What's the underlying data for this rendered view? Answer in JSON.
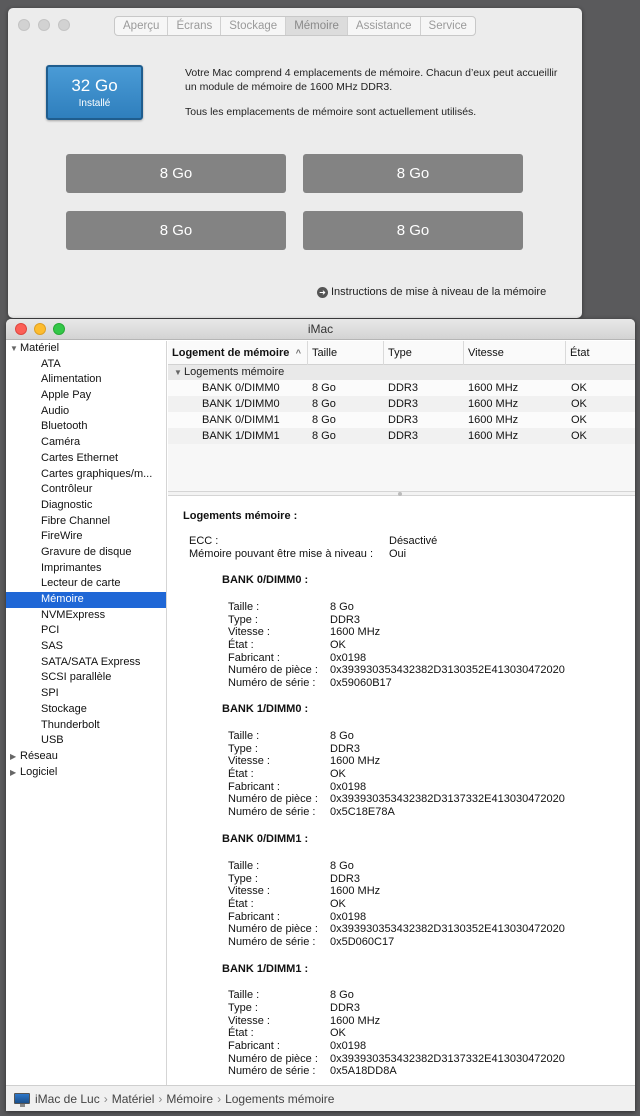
{
  "about": {
    "tabs": [
      "Aperçu",
      "Écrans",
      "Stockage",
      "Mémoire",
      "Assistance",
      "Service"
    ],
    "active_tab": "Mémoire",
    "ram_total": "32 Go",
    "ram_status": "Installé",
    "description_1": "Votre Mac comprend 4 emplacements de mémoire. Chacun d’eux peut accueillir un module de mémoire de 1600 MHz DDR3.",
    "description_2": "Tous les emplacements de mémoire sont actuellement utilisés.",
    "slots": [
      "8 Go",
      "8 Go",
      "8 Go",
      "8 Go"
    ],
    "upgrade_link": "Instructions de mise à niveau de la mémoire"
  },
  "sysinfo": {
    "title": "iMac",
    "sidebar": {
      "materiel_label": "Matériel",
      "items": [
        "ATA",
        "Alimentation",
        "Apple Pay",
        "Audio",
        "Bluetooth",
        "Caméra",
        "Cartes Ethernet",
        "Cartes graphiques/m...",
        "Contrôleur",
        "Diagnostic",
        "Fibre Channel",
        "FireWire",
        "Gravure de disque",
        "Imprimantes",
        "Lecteur de carte",
        "Mémoire",
        "NVMExpress",
        "PCI",
        "SAS",
        "SATA/SATA Express",
        "SCSI parallèle",
        "SPI",
        "Stockage",
        "Thunderbolt",
        "USB"
      ],
      "selected": "Mémoire",
      "reseau_label": "Réseau",
      "logiciel_label": "Logiciel"
    },
    "table": {
      "headers": [
        "Logement de mémoire",
        "Taille",
        "Type",
        "Vitesse",
        "État"
      ],
      "group": "Logements mémoire",
      "rows": [
        [
          "BANK 0/DIMM0",
          "8 Go",
          "DDR3",
          "1600 MHz",
          "OK"
        ],
        [
          "BANK 1/DIMM0",
          "8 Go",
          "DDR3",
          "1600 MHz",
          "OK"
        ],
        [
          "BANK 0/DIMM1",
          "8 Go",
          "DDR3",
          "1600 MHz",
          "OK"
        ],
        [
          "BANK 1/DIMM1",
          "8 Go",
          "DDR3",
          "1600 MHz",
          "OK"
        ]
      ]
    },
    "detail": {
      "heading": "Logements mémoire :",
      "ecc_label": "ECC :",
      "ecc_value": "Désactivé",
      "upgradeable_label": "Mémoire pouvant être mise à niveau :",
      "upgradeable_value": "Oui",
      "field_labels": [
        "Taille :",
        "Type :",
        "Vitesse :",
        "État :",
        "Fabricant :",
        "Numéro de pièce :",
        "Numéro de série :"
      ],
      "banks": [
        {
          "name": "BANK 0/DIMM0 :",
          "values": [
            "8 Go",
            "DDR3",
            "1600 MHz",
            "OK",
            "0x0198",
            "0x393930353432382D3130352E413030472020",
            "0x59060B17"
          ]
        },
        {
          "name": "BANK 1/DIMM0 :",
          "values": [
            "8 Go",
            "DDR3",
            "1600 MHz",
            "OK",
            "0x0198",
            "0x393930353432382D3137332E413030472020",
            "0x5C18E78A"
          ]
        },
        {
          "name": "BANK 0/DIMM1 :",
          "values": [
            "8 Go",
            "DDR3",
            "1600 MHz",
            "OK",
            "0x0198",
            "0x393930353432382D3130352E413030472020",
            "0x5D060C17"
          ]
        },
        {
          "name": "BANK 1/DIMM1 :",
          "values": [
            "8 Go",
            "DDR3",
            "1600 MHz",
            "OK",
            "0x0198",
            "0x393930353432382D3137332E413030472020",
            "0x5A18DD8A"
          ]
        }
      ]
    },
    "pathbar": [
      "iMac de Luc",
      "Matériel",
      "Mémoire",
      "Logements mémoire"
    ]
  }
}
